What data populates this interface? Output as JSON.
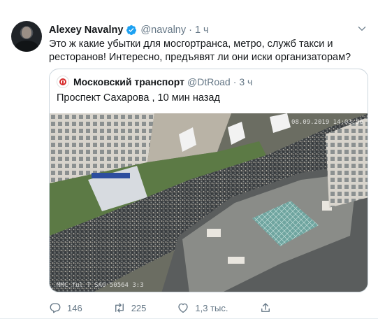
{
  "tweet": {
    "author_name": "Alexey Navalny",
    "handle": "@navalny",
    "separator": "·",
    "time": "1 ч",
    "text": "Это ж какие убытки для мосгортранса, метро, служб такси и ресторанов! Интересно, предъявят ли они иски организаторам?"
  },
  "quote": {
    "author_name": "Московский транспорт",
    "handle": "@DtRoad",
    "separator": "·",
    "time": "3 ч",
    "text": "Проспект Сахарова , 10 мин назад",
    "photo_watermark_top": "08.09.2019 14:03:56",
    "photo_watermark_bottom": "MMC_ful T SAO 50564 3:3"
  },
  "actions": {
    "replies": "146",
    "retweets": "225",
    "likes": "1,3 тыс."
  },
  "colors": {
    "text": "#14171a",
    "secondary": "#657786",
    "verified": "#1da1f2",
    "border": "#ccd6dd"
  },
  "icons": [
    "verified-badge-icon",
    "chevron-down-icon",
    "reply-icon",
    "retweet-icon",
    "like-icon",
    "share-icon"
  ]
}
